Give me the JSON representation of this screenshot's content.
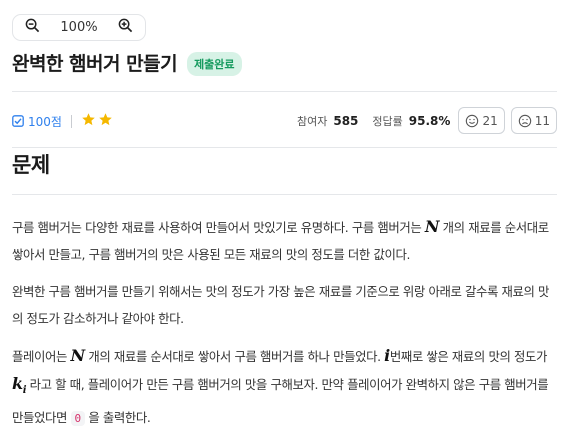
{
  "zoom": {
    "level": "100%",
    "out_icon": "zoom-out-icon",
    "in_icon": "zoom-in-icon"
  },
  "problem": {
    "title": "완벽한 햄버거 만들기",
    "status_badge": "제출완료"
  },
  "meta": {
    "points": "100점",
    "star_count": 2,
    "participants_label": "참여자",
    "participants_value": "585",
    "accuracy_label": "정답률",
    "accuracy_value": "95.8%",
    "like_count": "21",
    "dislike_count": "11"
  },
  "section": {
    "title": "문제"
  },
  "body": {
    "p1": {
      "t1": "구름 햄버거는 다양한 재료를 사용하여 만들어서 맛있기로 유명하다. 구름 햄버거는 ",
      "m1": "N",
      "t2": " 개의 재료를 순서대로 쌓아서 만들고, 구름 햄버거의 맛은 사용된 모든 재료의 맛의 정도를 더한 값이다."
    },
    "p2": {
      "t1": "완벽한 구름 햄버거를 만들기 위해서는 맛의 정도가 가장 높은 재료를 기준으로 위랑 아래로 갈수록 재료의 맛의 정도가 감소하거나 같아야 한다."
    },
    "p3": {
      "t1": "플레이어는 ",
      "m1": "N",
      "t2": " 개의 재료를 순서대로 쌓아서 구름 햄버거를 하나 만들었다. ",
      "m2": "i",
      "t3": "번째로 쌓은 재료의 맛의 정도가 ",
      "m3": "k",
      "m3_sub": "i",
      "t4": " 라고 할 때, 플레이어가 만든 구름 햄버거의 맛을 구해보자. 만약 플레이어가 완벽하지 않은 구름 햄버거를 만들었다면 ",
      "code": "0",
      "t5": " 을 출력한다."
    }
  },
  "colors": {
    "accent": "#2f80ed",
    "badge_bg": "#d7f2e6",
    "badge_text": "#159a5e",
    "star": "#f5b800",
    "code_text": "#d6336c"
  }
}
